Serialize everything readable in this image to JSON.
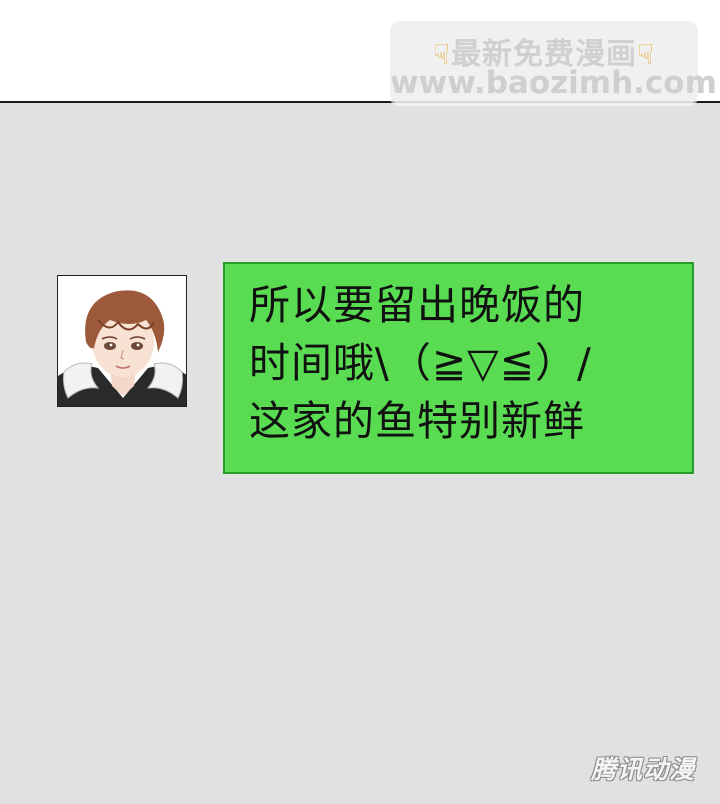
{
  "watermark": {
    "title": "最新免费漫画",
    "hand_icon": "pointing-down-hand",
    "url": "www.baozimh.com"
  },
  "message": {
    "sender_avatar": "boy-avatar",
    "lines": [
      "所以要留出晚饭的",
      "时间哦\\（≧▽≦）/",
      "这家的鱼特别新鲜"
    ],
    "bubble_color": "#59dc52"
  },
  "corner_logo": "腾讯动漫",
  "colors": {
    "chat_background": "#e1e1e1",
    "top_background": "#ffffff"
  }
}
